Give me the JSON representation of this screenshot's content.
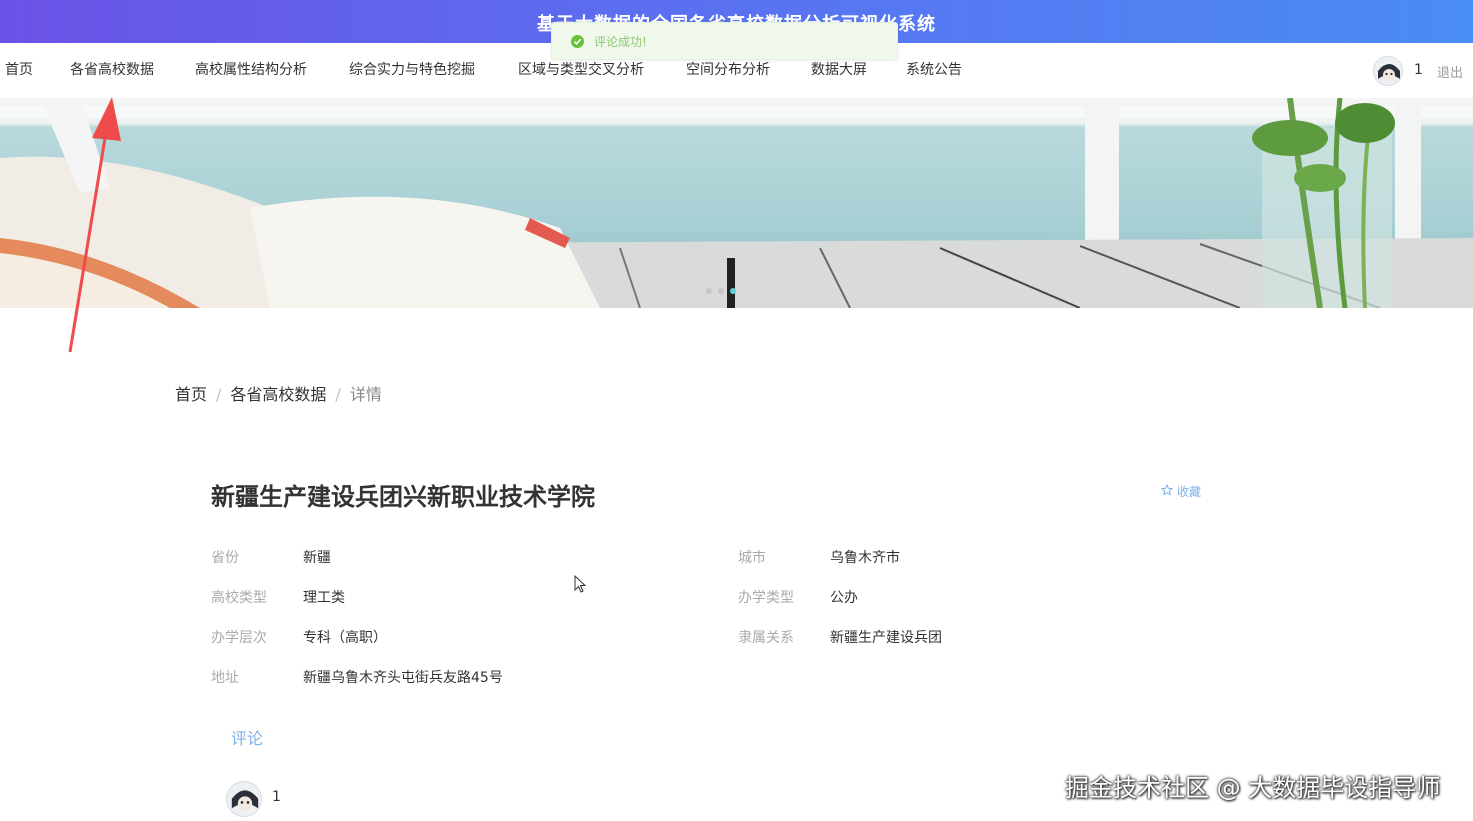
{
  "header": {
    "title": "基于大数据的全国各省高校数据分析可视化系统"
  },
  "toast": {
    "message": "评论成功!",
    "icon": "check-circle-icon"
  },
  "nav": {
    "items": [
      {
        "label": "首页"
      },
      {
        "label": "各省高校数据"
      },
      {
        "label": "高校属性结构分析"
      },
      {
        "label": "综合实力与特色挖掘"
      },
      {
        "label": "区域与类型交叉分析"
      },
      {
        "label": "空间分布分析"
      },
      {
        "label": "数据大屏"
      },
      {
        "label": "系统公告"
      }
    ],
    "user": {
      "name": "1",
      "logout": "退出"
    }
  },
  "banner": {
    "slides": 3,
    "active_slide": 3
  },
  "breadcrumb": {
    "items": [
      "首页",
      "各省高校数据",
      "详情"
    ]
  },
  "detail": {
    "name": "新疆生产建设兵团兴新职业技术学院",
    "favorite_label": "收藏",
    "favorite_icon": "star-outline-icon",
    "fields": {
      "province": {
        "label": "省份",
        "value": "新疆"
      },
      "city": {
        "label": "城市",
        "value": "乌鲁木齐市"
      },
      "school_type": {
        "label": "高校类型",
        "value": "理工类"
      },
      "run_type": {
        "label": "办学类型",
        "value": "公办"
      },
      "level": {
        "label": "办学层次",
        "value": "专科（高职）"
      },
      "affiliation": {
        "label": "隶属关系",
        "value": "新疆生产建设兵团"
      },
      "address": {
        "label": "地址",
        "value": "新疆乌鲁木齐头屯街兵友路45号"
      }
    }
  },
  "comments": {
    "tab_label": "评论",
    "items": [
      {
        "user": "1"
      }
    ]
  },
  "watermark": "掘金技术社区 @ 大数据毕设指导师",
  "colors": {
    "header_start": "#6a52e6",
    "header_end": "#4a8cf5",
    "accent": "#7fb0e8",
    "success": "#67c23a",
    "arrow": "#f04b4b"
  }
}
